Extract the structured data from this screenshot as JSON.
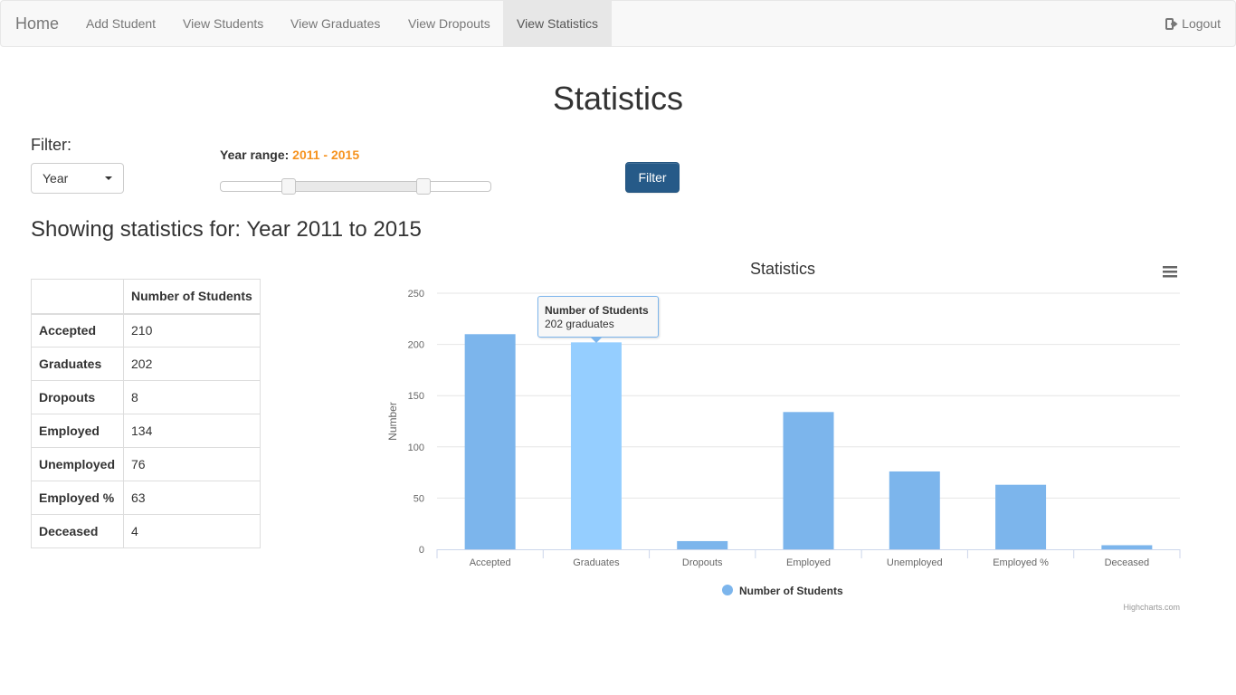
{
  "navbar": {
    "brand": "Home",
    "links": [
      "Add Student",
      "View Students",
      "View Graduates",
      "View Dropouts",
      "View Statistics"
    ],
    "active": "View Statistics",
    "logout": "Logout"
  },
  "page_title": "Statistics",
  "filter": {
    "label": "Filter:",
    "select_value": "Year",
    "range_label": "Year range:",
    "range_value": "2011 - 2015",
    "range_min_fraction": 0.25,
    "range_max_fraction": 0.75,
    "button": "Filter"
  },
  "showing_text": "Showing statistics for: Year 2011 to 2015",
  "table": {
    "header": [
      "",
      "Number of Students"
    ],
    "rows": [
      {
        "label": "Accepted",
        "value": "210"
      },
      {
        "label": "Graduates",
        "value": "202"
      },
      {
        "label": "Dropouts",
        "value": "8"
      },
      {
        "label": "Employed",
        "value": "134"
      },
      {
        "label": "Unemployed",
        "value": "76"
      },
      {
        "label": "Employed %",
        "value": "63"
      },
      {
        "label": "Deceased",
        "value": "4"
      }
    ]
  },
  "tooltip": {
    "title": "Number of Students",
    "text": "202 graduates"
  },
  "colors": {
    "bar": "#7cb5ec",
    "bar_hover": "#95ceff",
    "range_value": "#f6931f",
    "button": "#265a88"
  },
  "chart_data": {
    "type": "bar",
    "title": "Statistics",
    "ylabel": "Number",
    "xlabel": "",
    "ylim": [
      0,
      250
    ],
    "yticks": [
      0,
      50,
      100,
      150,
      200,
      250
    ],
    "categories": [
      "Accepted",
      "Graduates",
      "Dropouts",
      "Employed",
      "Unemployed",
      "Employed %",
      "Deceased"
    ],
    "series": [
      {
        "name": "Number of Students",
        "values": [
          210,
          202,
          8,
          134,
          76,
          63,
          4
        ]
      }
    ],
    "highlighted_index": 1,
    "legend": "bottom-center",
    "grid": true,
    "credits": "Highcharts.com",
    "menu_icon": "hamburger-menu-icon"
  }
}
